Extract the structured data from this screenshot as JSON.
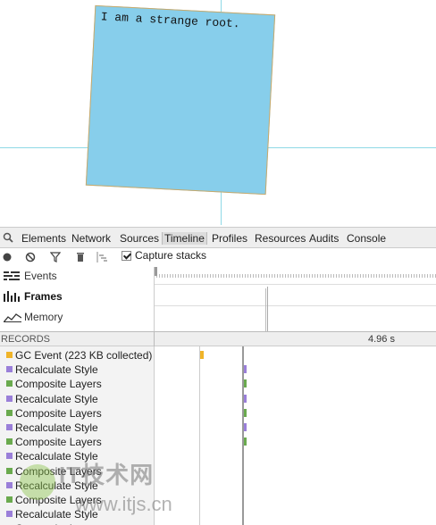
{
  "page": {
    "box_text": "I am a strange root.",
    "box_color": "#87ceeb",
    "box_border_color": "#c9a96a",
    "guide_color": "#8fd9e6"
  },
  "devtools": {
    "tabs": [
      "Elements",
      "Network",
      "Sources",
      "Timeline",
      "Profiles",
      "Resources",
      "Audits",
      "Console"
    ],
    "active_tab": "Timeline",
    "toolbar": {
      "icons": [
        "record-icon",
        "clear-icon",
        "filter-icon",
        "garbage-collect-icon",
        "glue-icon"
      ],
      "capture_stacks_label": "Capture stacks",
      "capture_stacks_checked": true
    },
    "overview": {
      "items": [
        {
          "label": "Events",
          "icon": "events-icon"
        },
        {
          "label": "Frames",
          "icon": "frames-icon",
          "selected": true
        },
        {
          "label": "Memory",
          "icon": "memory-icon"
        }
      ]
    },
    "records_title": "RECORDS",
    "time_label": "4.96 s",
    "records": [
      {
        "name": "GC Event (223 KB collected)",
        "color": "#f0b429"
      },
      {
        "name": "Recalculate Style",
        "color": "#9a7fd9"
      },
      {
        "name": "Composite Layers",
        "color": "#6aaa4e"
      },
      {
        "name": "Recalculate Style",
        "color": "#9a7fd9"
      },
      {
        "name": "Composite Layers",
        "color": "#6aaa4e"
      },
      {
        "name": "Recalculate Style",
        "color": "#9a7fd9"
      },
      {
        "name": "Composite Layers",
        "color": "#6aaa4e"
      },
      {
        "name": "Recalculate Style",
        "color": "#9a7fd9"
      },
      {
        "name": "Composite Layers",
        "color": "#6aaa4e"
      },
      {
        "name": "Recalculate Style",
        "color": "#9a7fd9"
      },
      {
        "name": "Composite Layers",
        "color": "#6aaa4e"
      },
      {
        "name": "Recalculate Style",
        "color": "#9a7fd9"
      },
      {
        "name": "Composite Layers",
        "color": "#6aaa4e"
      }
    ]
  },
  "watermark": {
    "line1": "IT技术网",
    "line2": "www.itjs.cn"
  }
}
